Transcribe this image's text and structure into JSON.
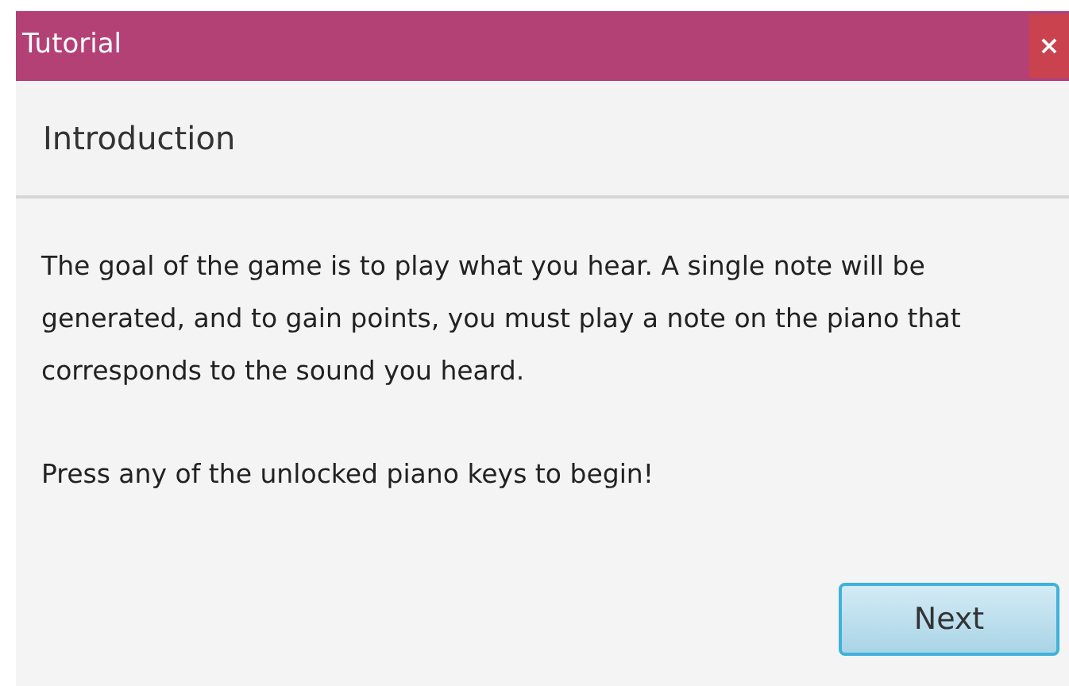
{
  "window": {
    "title": "Tutorial",
    "close": "×"
  },
  "header": {
    "title": "Introduction"
  },
  "body": {
    "paragraphs": [
      "The goal of the game is to play what you hear. A single note will be generated, and to gain points, you must play a note on the piano that corresponds to the sound you heard.",
      "Press any of the unlocked piano keys to begin!"
    ]
  },
  "buttons": [
    {
      "label": "Next"
    }
  ]
}
